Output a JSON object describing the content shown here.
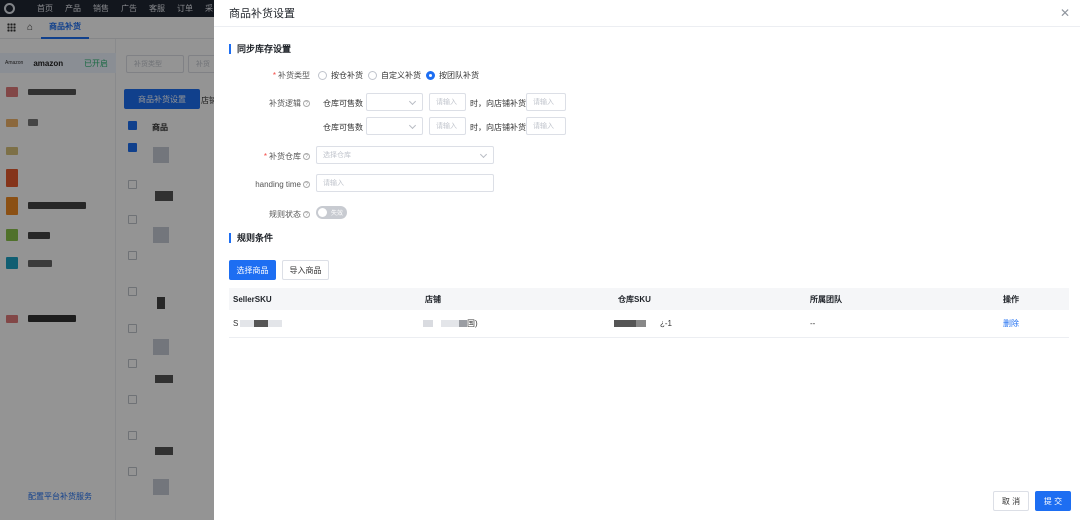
{
  "topnav": [
    "首页",
    "产品",
    "销售",
    "广告",
    "客服",
    "订单",
    "采"
  ],
  "subtab": "商品补货",
  "left": {
    "store_small": "Amazon",
    "store_name": "amazon",
    "store_status": "已开启",
    "footer_link": "配置平台补货服务"
  },
  "bg": {
    "filter1": "补货类型",
    "filter2": "补货",
    "settings_button": "商品补货设置",
    "tab_partial": "店铺",
    "col_product": "商品"
  },
  "drawer": {
    "title": "商品补货设置",
    "section1": "同步库存设置",
    "type_label": "补货类型",
    "type_options": [
      "按仓补货",
      "自定义补货",
      "按团队补货"
    ],
    "selected_type": "按团队补货",
    "logic_label": "补货逻辑",
    "logic_rows": [
      {
        "label": "仓库可售数",
        "input1": "请输入",
        "mid": "时，向店铺补货",
        "input2": "请输入"
      },
      {
        "label": "仓库可售数",
        "input1": "请输入",
        "mid": "时，向店铺补货",
        "input2": "请输入"
      }
    ],
    "warehouse_label": "补货仓库",
    "warehouse_placeholder": "选择仓库",
    "handing_label": "handing time",
    "handing_placeholder": "请输入",
    "rule_status_label": "规则状态",
    "rule_status_value": "失效",
    "section2": "规则条件",
    "select_goods": "选择商品",
    "import_goods": "导入商品",
    "table": {
      "headers": [
        "SellerSKU",
        "店铺",
        "仓库SKU",
        "所属团队",
        "操作"
      ],
      "rows": [
        {
          "sku_prefix": "S",
          "store_suffix": "国)",
          "wsku_suffix": "-1",
          "team": "--",
          "action": "删除"
        }
      ]
    },
    "cancel": "取 消",
    "submit": "提 交"
  }
}
